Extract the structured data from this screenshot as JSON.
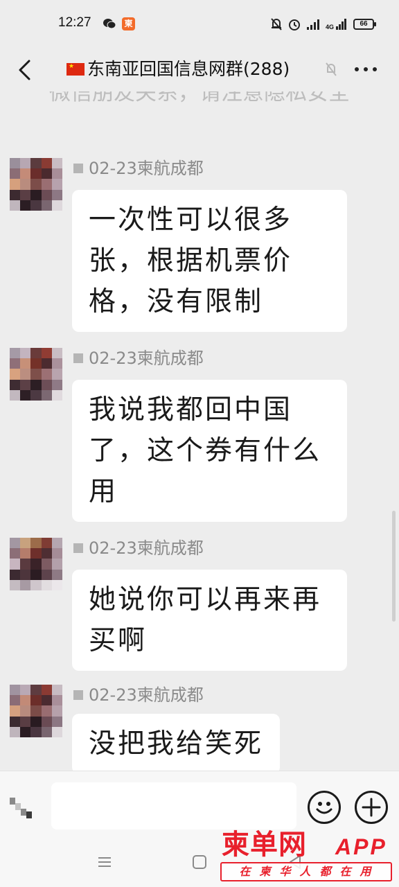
{
  "status_bar": {
    "time": "12:27",
    "left_icons": [
      "wechat-icon",
      "app-notification-icon"
    ],
    "app_icon_text": "柬",
    "right_icons": [
      "mute-bell-icon",
      "alarm-icon",
      "signal-icon",
      "4g-signal-icon",
      "battery-icon"
    ],
    "network_label": "4G",
    "battery": "66"
  },
  "header": {
    "title": "东南亚回国信息网群(288)",
    "flag": "china-flag-icon",
    "back_icon": "back-chevron-icon",
    "more_icon": "more-dots-icon"
  },
  "chat": {
    "system_notice": "微信朋友关系，请注意隐私安全",
    "messages": [
      {
        "sender": "02-23柬航成都",
        "text": "一次性可以很多张，根据机票价格，没有限制"
      },
      {
        "sender": "02-23柬航成都",
        "text": "我说我都回中国了，这个券有什么用"
      },
      {
        "sender": "02-23柬航成都",
        "text": "她说你可以再来再买啊"
      },
      {
        "sender": "02-23柬航成都",
        "text": "没把我给笑死"
      }
    ]
  },
  "input_bar": {
    "placeholder": "",
    "voice_icon": "voice-icon",
    "emoji_icon": "emoji-icon",
    "plus_icon": "plus-icon"
  },
  "system_nav": {
    "icons": [
      "menu-icon",
      "home-icon",
      "back-triangle-icon"
    ]
  },
  "watermark": {
    "logo_text": "柬单网",
    "app_text": "APP",
    "slogan": "在柬华人都在用"
  },
  "colors": {
    "background": "#ededed",
    "bubble": "#ffffff",
    "watermark": "#e8202c",
    "sender_name": "#8a8a8a"
  }
}
